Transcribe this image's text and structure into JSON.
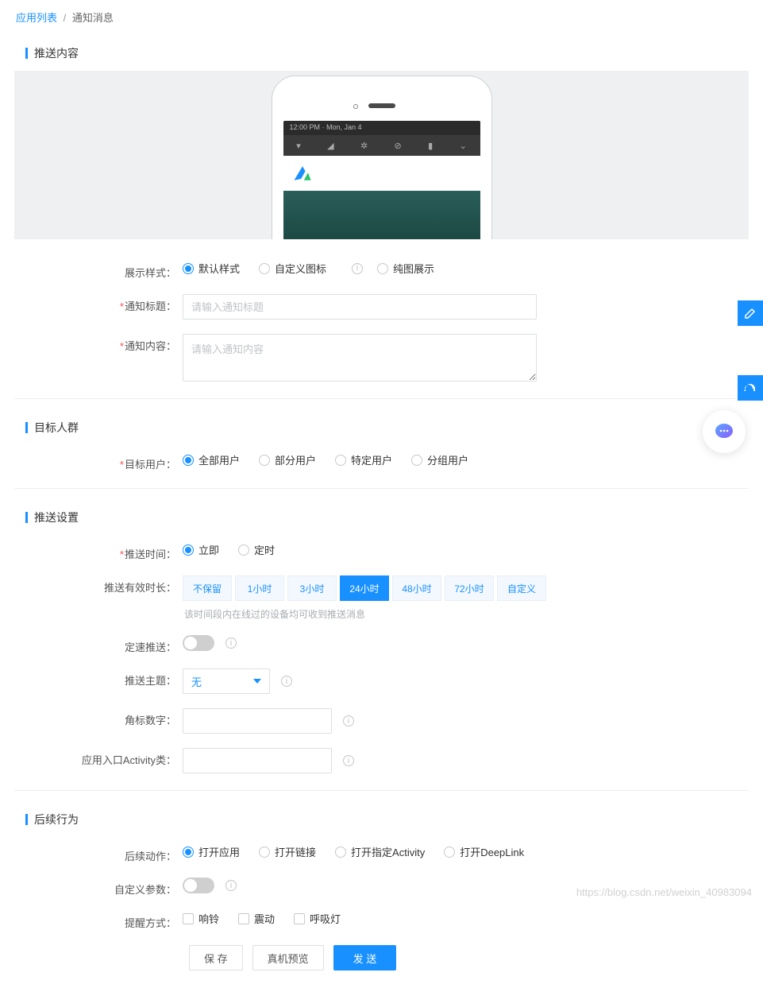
{
  "breadcrumb": {
    "link": "应用列表",
    "current": "通知消息"
  },
  "sections": {
    "push_content": "推送内容",
    "target": "目标人群",
    "push_setting": "推送设置",
    "followup": "后续行为"
  },
  "phone_status": "12:00 PM · Mon, Jan 4",
  "form": {
    "display_style": {
      "label": "展示样式：",
      "opts": [
        "默认样式",
        "自定义图标",
        "纯图展示"
      ]
    },
    "title": {
      "label": "通知标题：",
      "placeholder": "请输入通知标题"
    },
    "content": {
      "label": "通知内容：",
      "placeholder": "请输入通知内容"
    },
    "target_user": {
      "label": "目标用户：",
      "opts": [
        "全部用户",
        "部分用户",
        "特定用户",
        "分组用户"
      ]
    },
    "push_time": {
      "label": "推送时间：",
      "opts": [
        "立即",
        "定时"
      ]
    },
    "valid_time": {
      "label": "推送有效时长：",
      "opts": [
        "不保留",
        "1小时",
        "3小时",
        "24小时",
        "48小时",
        "72小时",
        "自定义"
      ],
      "active": 3,
      "hint": "该时间段内在线过的设备均可收到推送消息"
    },
    "rate_push": {
      "label": "定速推送："
    },
    "push_theme": {
      "label": "推送主题：",
      "value": "无"
    },
    "badge": {
      "label": "角标数字："
    },
    "activity_class": {
      "label": "应用入口Activity类："
    },
    "followup_action": {
      "label": "后续动作：",
      "opts": [
        "打开应用",
        "打开链接",
        "打开指定Activity",
        "打开DeepLink"
      ]
    },
    "custom_params": {
      "label": "自定义参数："
    },
    "alert_mode": {
      "label": "提醒方式：",
      "opts": [
        "响铃",
        "震动",
        "呼吸灯"
      ]
    }
  },
  "buttons": {
    "save": "保 存",
    "preview": "真机预览",
    "send": "发 送"
  },
  "info_char": "i",
  "watermark": "https://blog.csdn.net/weixin_40983094"
}
